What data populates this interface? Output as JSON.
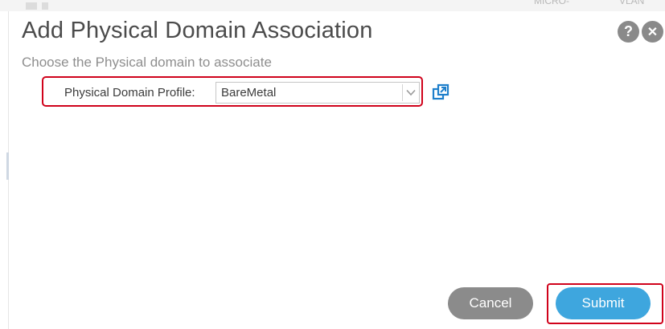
{
  "background": {
    "header_fragments": [
      "MICRO-",
      "VLAN"
    ]
  },
  "dialog": {
    "title": "Add Physical Domain Association",
    "subtitle": "Choose the Physical domain to associate",
    "help_icon": "question-circle-icon",
    "close_icon": "close-circle-icon",
    "help_glyph": "?",
    "close_glyph": "✕"
  },
  "form": {
    "physical_domain_profile": {
      "label": "Physical Domain Profile:",
      "value": "BareMetal",
      "dropdown_icon": "chevron-down-icon",
      "link_icon": "open-external-icon"
    }
  },
  "actions": {
    "cancel_label": "Cancel",
    "submit_label": "Submit"
  },
  "colors": {
    "title_text": "#4b4b4b",
    "subtitle_text": "#8e8e8e",
    "highlight_red": "#d0021b",
    "submit_blue": "#3ea6de",
    "cancel_gray": "#8b8b8b",
    "link_blue": "#1e7fcb"
  }
}
